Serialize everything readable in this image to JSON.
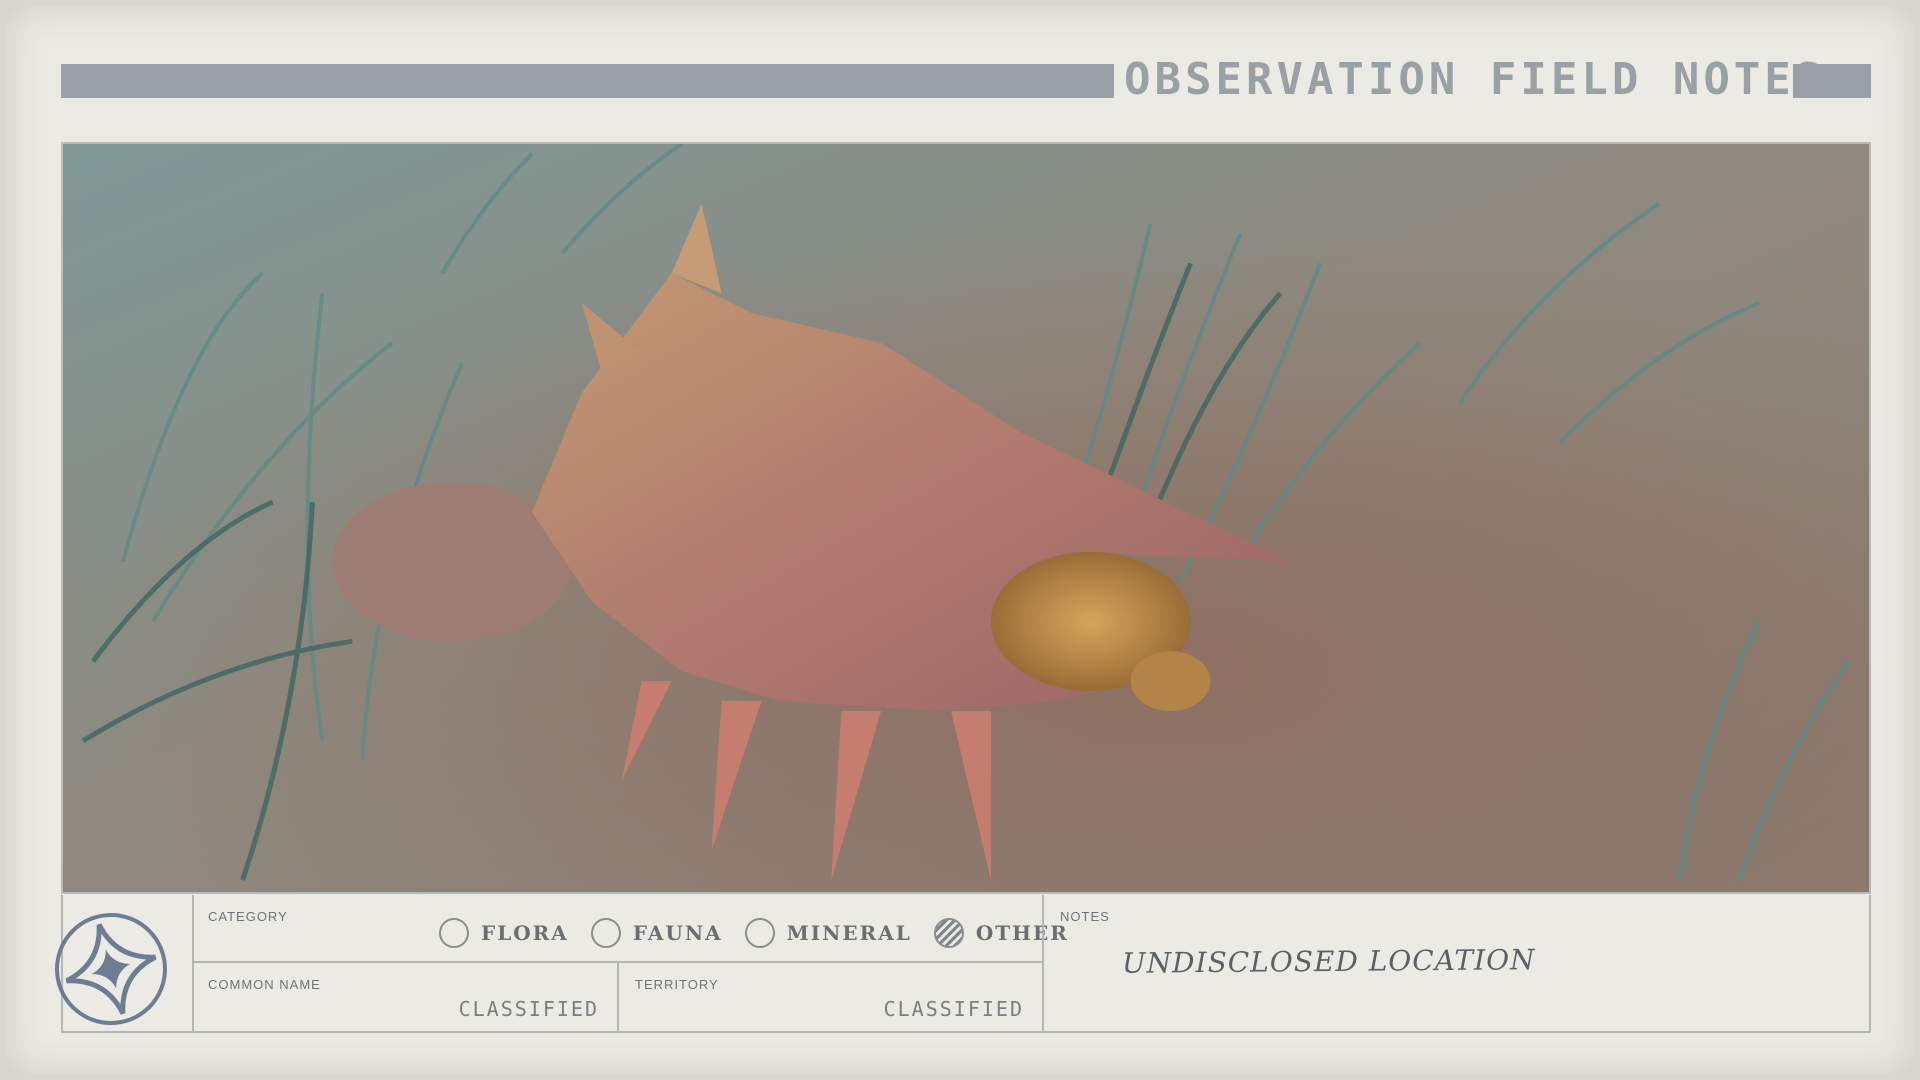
{
  "header": {
    "title": "OBSERVATION FIELD NOTES"
  },
  "form": {
    "category_label": "CATEGORY",
    "categories": [
      {
        "label": "FLORA",
        "selected": false
      },
      {
        "label": "FAUNA",
        "selected": false
      },
      {
        "label": "MINERAL",
        "selected": false
      },
      {
        "label": "OTHER",
        "selected": true
      }
    ],
    "common_name_label": "COMMON NAME",
    "common_name_value": "CLASSIFIED",
    "territory_label": "TERRITORY",
    "territory_value": "CLASSIFIED",
    "notes_label": "NOTES",
    "notes_value": "UNDISCLOSED LOCATION"
  },
  "colors": {
    "card_bg": "#eceae4",
    "header_gray": "#9aa1a6",
    "ink": "#6a6f73"
  },
  "icons": {
    "logo": "four-point-star-emblem-icon",
    "radio_selected": "hatched-radio-icon"
  }
}
